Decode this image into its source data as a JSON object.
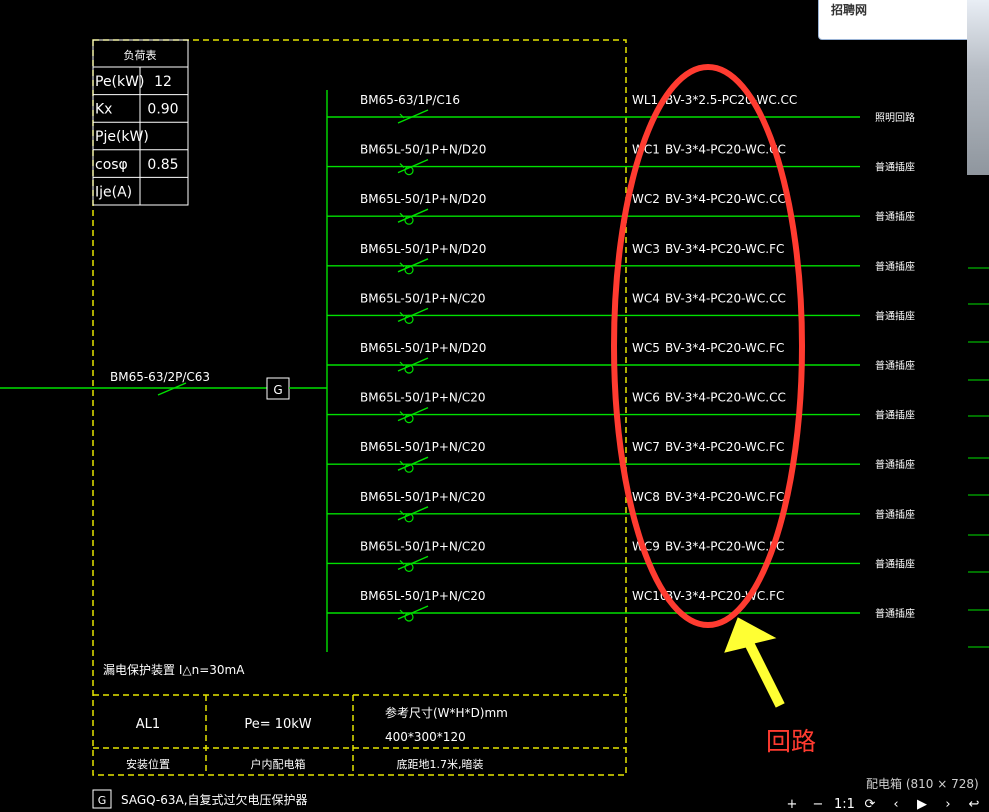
{
  "popup": {
    "label": "招聘网"
  },
  "table": {
    "title": "负荷表",
    "rows": [
      {
        "label": "Pe(kW)",
        "value": "12"
      },
      {
        "label": "Kx",
        "value": "0.90"
      },
      {
        "label": "Pje(kW)",
        "value": ""
      },
      {
        "label": "cosφ",
        "value": "0.85"
      },
      {
        "label": "Ije(A)",
        "value": ""
      }
    ]
  },
  "main_breaker": "BM65-63/2P/C63",
  "g_symbol": "G",
  "circuits": [
    {
      "breaker": "BM65-63/1P/C16",
      "code": "WL1",
      "cable": "BV-3*2.5-PC20-WC.CC",
      "use": "照明回路",
      "rcd": false
    },
    {
      "breaker": "BM65L-50/1P+N/D20",
      "code": "WC1",
      "cable": "BV-3*4-PC20-WC.CC",
      "use": "普通插座",
      "rcd": true
    },
    {
      "breaker": "BM65L-50/1P+N/D20",
      "code": "WC2",
      "cable": "BV-3*4-PC20-WC.CC",
      "use": "普通插座",
      "rcd": true
    },
    {
      "breaker": "BM65L-50/1P+N/D20",
      "code": "WC3",
      "cable": "BV-3*4-PC20-WC.FC",
      "use": "普通插座",
      "rcd": true
    },
    {
      "breaker": "BM65L-50/1P+N/C20",
      "code": "WC4",
      "cable": "BV-3*4-PC20-WC.CC",
      "use": "普通插座",
      "rcd": true
    },
    {
      "breaker": "BM65L-50/1P+N/D20",
      "code": "WC5",
      "cable": "BV-3*4-PC20-WC.FC",
      "use": "普通插座",
      "rcd": true
    },
    {
      "breaker": "BM65L-50/1P+N/C20",
      "code": "WC6",
      "cable": "BV-3*4-PC20-WC.CC",
      "use": "普通插座",
      "rcd": true
    },
    {
      "breaker": "BM65L-50/1P+N/C20",
      "code": "WC7",
      "cable": "BV-3*4-PC20-WC.FC",
      "use": "普通插座",
      "rcd": true
    },
    {
      "breaker": "BM65L-50/1P+N/C20",
      "code": "WC8",
      "cable": "BV-3*4-PC20-WC.FC",
      "use": "普通插座",
      "rcd": true
    },
    {
      "breaker": "BM65L-50/1P+N/C20",
      "code": "WC9",
      "cable": "BV-3*4-PC20-WC.FC",
      "use": "普通插座",
      "rcd": true
    },
    {
      "breaker": "BM65L-50/1P+N/C20",
      "code": "WC10",
      "cable": "BV-3*4-PC20-WC.FC",
      "use": "普通插座",
      "rcd": true
    }
  ],
  "rcd_note": "漏电保护装置 I△n=30mA",
  "footer": {
    "panel_id": "AL1",
    "power": "Pe= 10kW",
    "size_label": "参考尺寸(W*H*D)mm",
    "size_value": "400*300*120",
    "install_label": "安装位置",
    "location": "户内配电箱",
    "mount": "底距地1.7米,暗装"
  },
  "legend": {
    "symbol": "G",
    "text": "SAGQ-63A,自复式过欠电压保护器"
  },
  "annotation": "回路",
  "caption": "配电箱 (810 × 728)",
  "toolbar": [
    "+",
    "−",
    "1:1",
    "⟳",
    "‹",
    "▶",
    "›",
    "↩"
  ],
  "colors": {
    "dash_border": "#e6e600",
    "wire": "#00e000",
    "ellipse": "#ff3b30",
    "arrow": "#ffff33"
  }
}
